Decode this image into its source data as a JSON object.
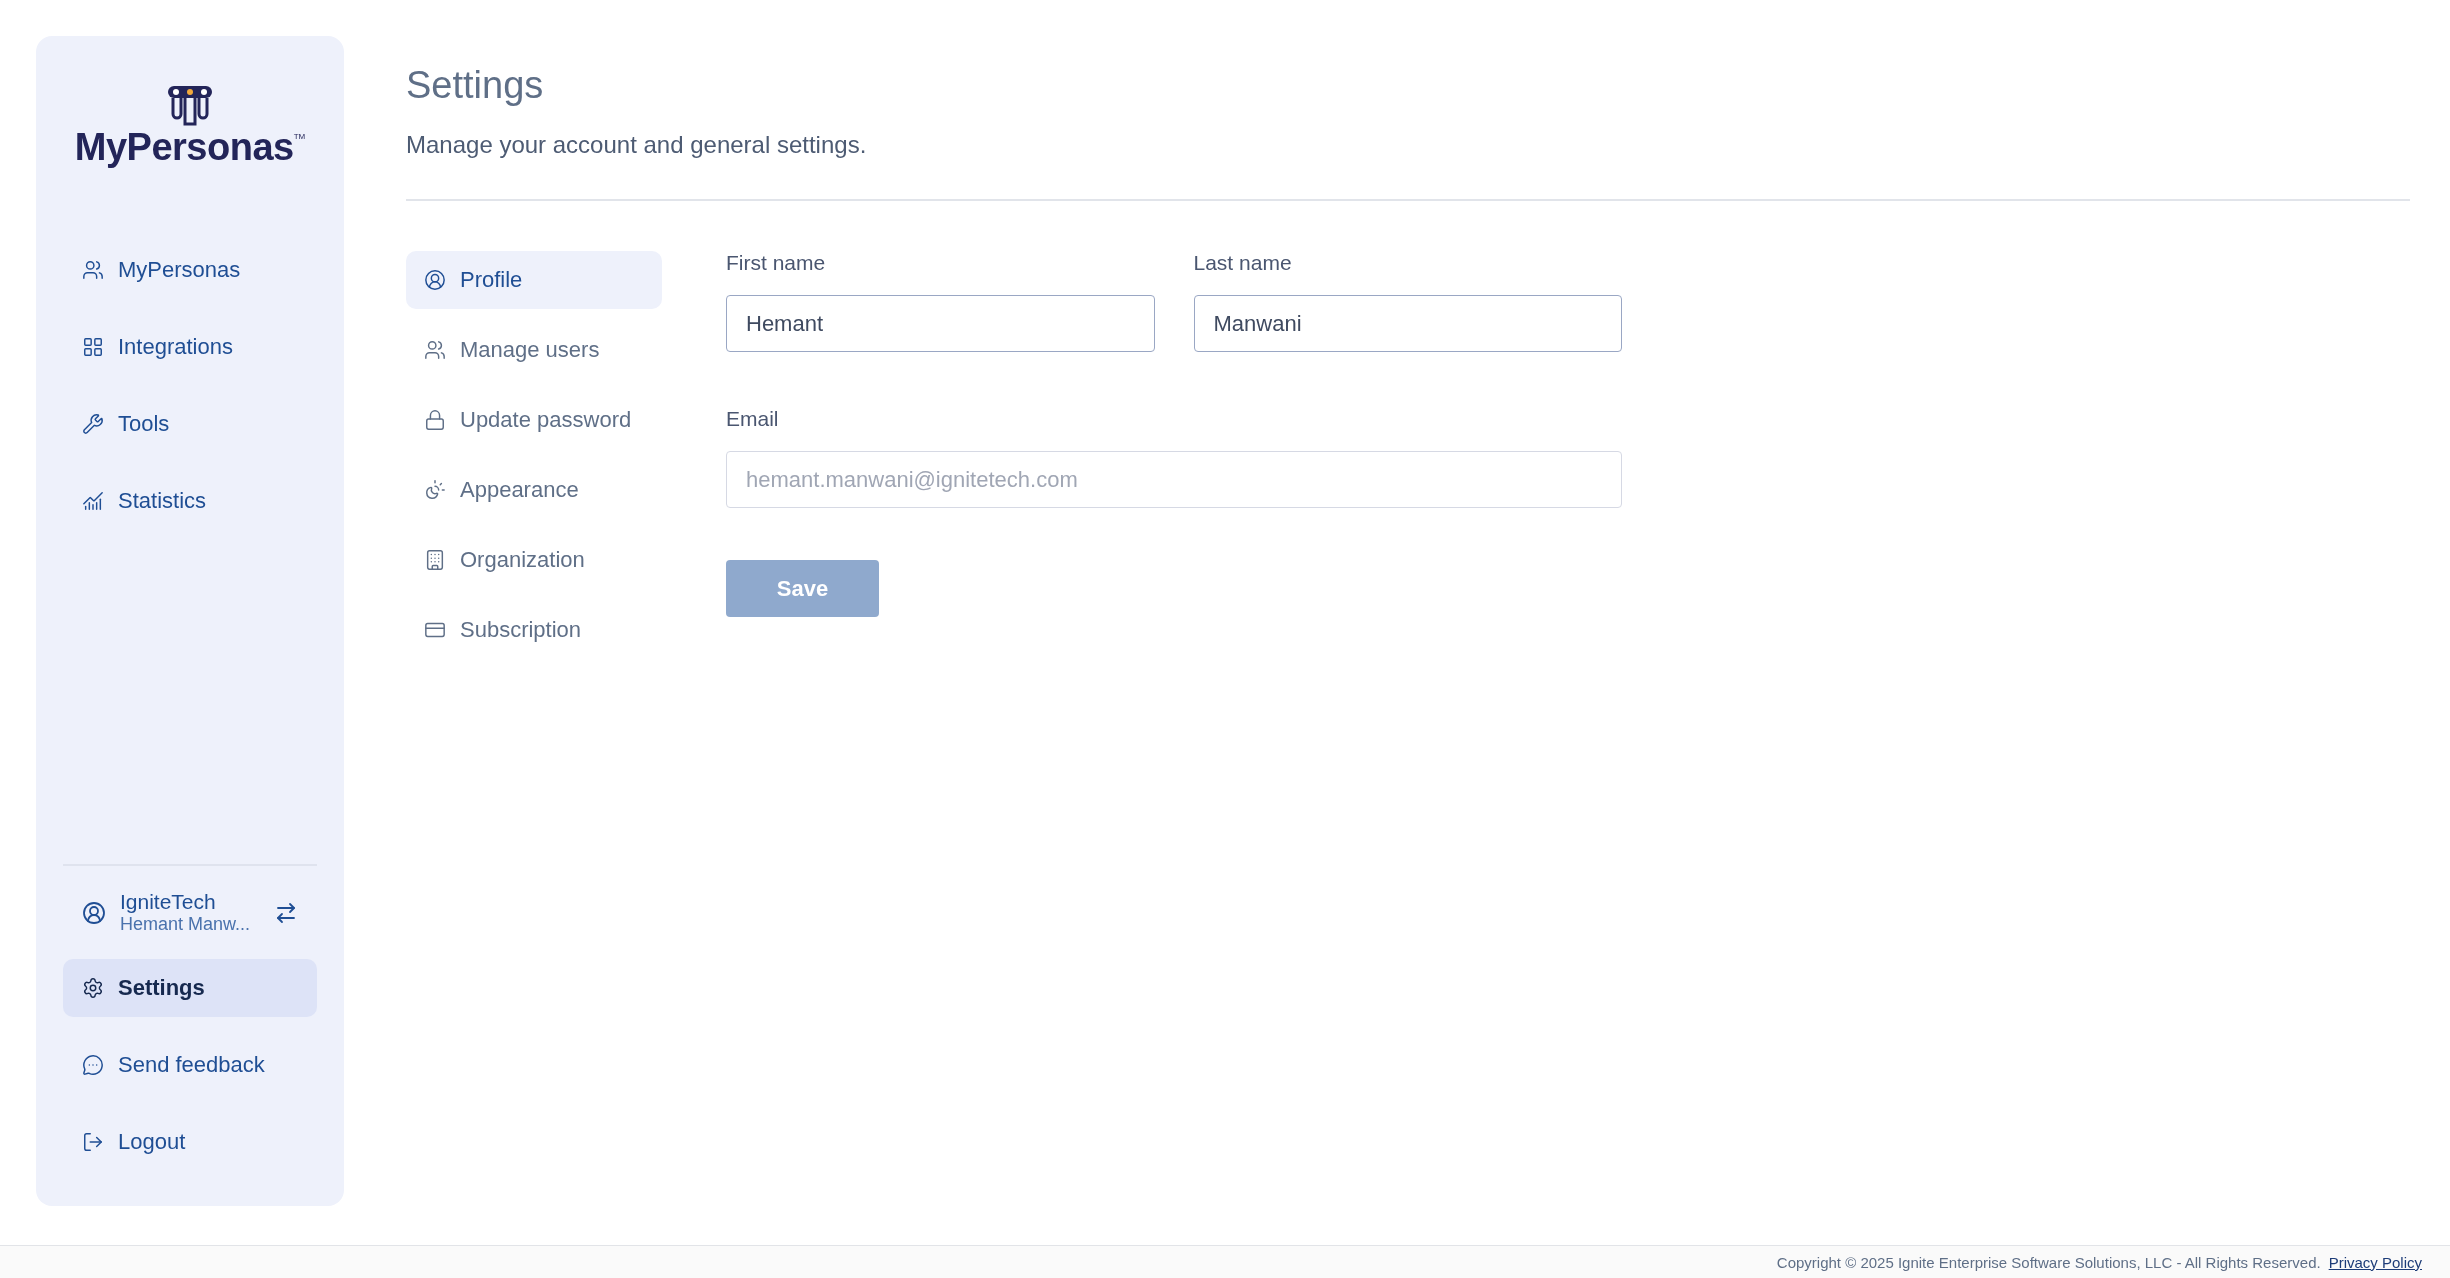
{
  "sidebar": {
    "logo": {
      "name": "MyPersonas",
      "mark": "TM"
    },
    "nav": [
      {
        "label": "MyPersonas",
        "selected": false
      },
      {
        "label": "Integrations",
        "selected": false
      },
      {
        "label": "Tools",
        "selected": false
      },
      {
        "label": "Statistics",
        "selected": false
      }
    ],
    "account": {
      "organization": "IgniteTech",
      "user": "Hemant Manw..."
    },
    "bottom_nav": [
      {
        "label": "Settings",
        "selected": true
      },
      {
        "label": "Send feedback",
        "selected": false
      },
      {
        "label": "Logout",
        "selected": false
      }
    ]
  },
  "page": {
    "title": "Settings",
    "subtitle": "Manage your account and general settings."
  },
  "settings_nav": [
    {
      "label": "Profile",
      "selected": true
    },
    {
      "label": "Manage users",
      "selected": false
    },
    {
      "label": "Update password",
      "selected": false
    },
    {
      "label": "Appearance",
      "selected": false
    },
    {
      "label": "Organization",
      "selected": false
    },
    {
      "label": "Subscription",
      "selected": false
    }
  ],
  "form": {
    "first_name": {
      "label": "First name",
      "value": "Hemant"
    },
    "last_name": {
      "label": "Last name",
      "value": "Manwani"
    },
    "email": {
      "label": "Email",
      "value": "hemant.manwani@ignitetech.com",
      "disabled": true
    },
    "save": {
      "label": "Save",
      "disabled": true
    }
  },
  "footer": {
    "copyright": "Copyright © 2025 Ignite Enterprise Software Solutions, LLC - All Rights Reserved.",
    "link": "Privacy Policy"
  }
}
